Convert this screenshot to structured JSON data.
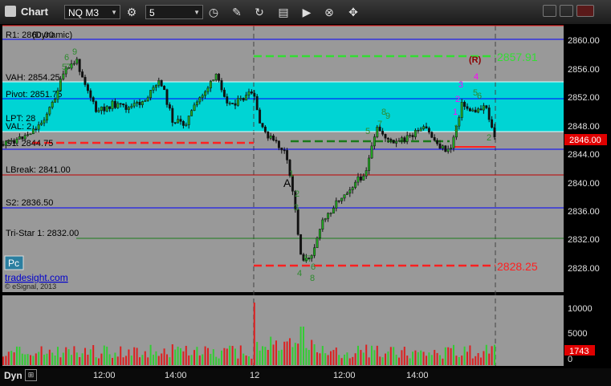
{
  "window": {
    "title": "Chart"
  },
  "toolbar": {
    "symbol": "NQ M3",
    "interval": "5"
  },
  "price_labels": {
    "r1": "R1: 2860.00",
    "r1_dynamic": "(Dynamic)",
    "vah": "VAH: 2854.25",
    "pivot": "Pivot: 2851.75",
    "lpt": "LPT: 28",
    "val": "VAL: 2",
    "s1": "S1: 2844.75",
    "lbreak": "LBreak: 2841.00",
    "s2": "S2: 2836.50",
    "tristar": "Tri-Star 1: 2832.00"
  },
  "targets": {
    "upper": "2857.91",
    "lower": "2828.25",
    "reversal": "(R)"
  },
  "current_price": "2846.00",
  "current_volume": "1743",
  "watermark": {
    "badge": "Pc",
    "site": "tradesight.com",
    "copyright": "© eSignal, 2013"
  },
  "y_axis": [
    "2860.00",
    "2856.00",
    "2852.00",
    "2848.00",
    "2844.00",
    "2840.00",
    "2836.00",
    "2832.00",
    "2828.00"
  ],
  "volume_axis": [
    "10000",
    "5000",
    "0"
  ],
  "x_axis": [
    "12:00",
    "14:00",
    "12",
    "12:00",
    "14:00"
  ],
  "footer": {
    "label": "Dyn"
  },
  "colors": {
    "background": "#999999",
    "value_area": "#00d4d4",
    "red": "#ff2020",
    "green": "#33cc33",
    "blue": "#0000ff",
    "magenta": "#ff00ff"
  },
  "chart_data": {
    "type": "candlestick",
    "instrument": "NQ M3",
    "interval_minutes": 5,
    "ylim": [
      2826,
      2862
    ],
    "levels": [
      {
        "name": "R1",
        "value": 2860.0
      },
      {
        "name": "VAH",
        "value": 2854.25
      },
      {
        "name": "Pivot",
        "value": 2851.75
      },
      {
        "name": "S1",
        "value": 2844.75
      },
      {
        "name": "LBreak",
        "value": 2841.0
      },
      {
        "name": "S2",
        "value": 2836.5
      },
      {
        "name": "Tri-Star 1",
        "value": 2832.0
      }
    ],
    "targets": [
      2857.91,
      2828.25
    ],
    "last_price": 2846.0,
    "last_volume": 1743,
    "volume_ylim": [
      0,
      12000
    ]
  }
}
